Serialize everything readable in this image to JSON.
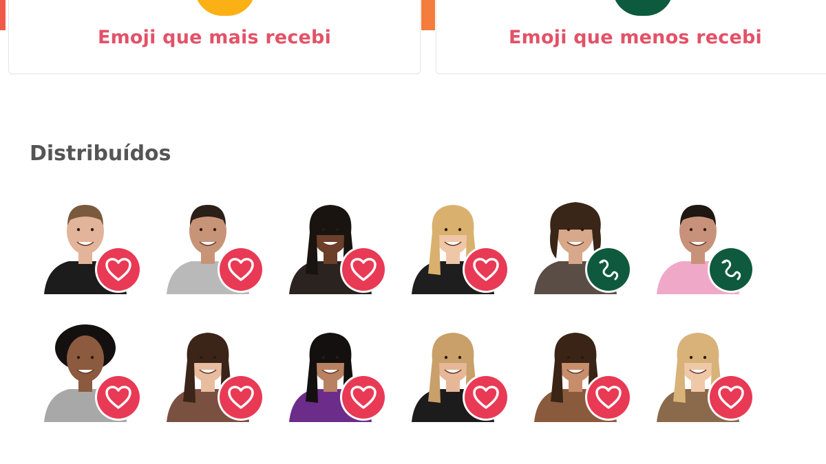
{
  "cards": {
    "most_received": {
      "title": "Emoji que mais recebi",
      "emoji_color": "#fbb016"
    },
    "least_received": {
      "title": "Emoji que menos recebi",
      "emoji_color": "#0d5a3f"
    }
  },
  "section": {
    "title": "Distribuídos"
  },
  "colors": {
    "accent_text": "#e25268",
    "heart_badge": "#e83a55",
    "snake_badge": "#0f5a3e"
  },
  "participants": [
    {
      "emoji": "heart-icon",
      "skin": "#e2b49a",
      "hair": "#7a5a3c",
      "shirt": "#1c1c1c",
      "hair_style": "short"
    },
    {
      "emoji": "heart-icon",
      "skin": "#c89478",
      "hair": "#2a2018",
      "shirt": "#b9b9b9",
      "hair_style": "short"
    },
    {
      "emoji": "heart-icon",
      "skin": "#6b3f2a",
      "hair": "#1a1411",
      "shirt": "#2a2320",
      "hair_style": "long"
    },
    {
      "emoji": "heart-icon",
      "skin": "#efc6a6",
      "hair": "#d9b06e",
      "shirt": "#1e1e1e",
      "hair_style": "long"
    },
    {
      "emoji": "snake-icon",
      "skin": "#d7a88a",
      "hair": "#3a2618",
      "shirt": "#5a4d45",
      "hair_style": "curly"
    },
    {
      "emoji": "snake-icon",
      "skin": "#c8927a",
      "hair": "#1e1712",
      "shirt": "#f0a8c8",
      "hair_style": "short"
    },
    {
      "emoji": "heart-icon",
      "skin": "#8c5a3e",
      "hair": "#151010",
      "shirt": "#a8a8a8",
      "hair_style": "afro"
    },
    {
      "emoji": "heart-icon",
      "skin": "#e8bc9f",
      "hair": "#3b2418",
      "shirt": "#7a5040",
      "hair_style": "long"
    },
    {
      "emoji": "heart-icon",
      "skin": "#b88262",
      "hair": "#141010",
      "shirt": "#6c2c8a",
      "hair_style": "long"
    },
    {
      "emoji": "heart-icon",
      "skin": "#e6b898",
      "hair": "#c9a06a",
      "shirt": "#1c1c1c",
      "hair_style": "long"
    },
    {
      "emoji": "heart-icon",
      "skin": "#c88e6c",
      "hair": "#3a2416",
      "shirt": "#8a5a3c",
      "hair_style": "long"
    },
    {
      "emoji": "heart-icon",
      "skin": "#efc8a8",
      "hair": "#d9b27a",
      "shirt": "#8a6a4a",
      "hair_style": "long"
    }
  ]
}
